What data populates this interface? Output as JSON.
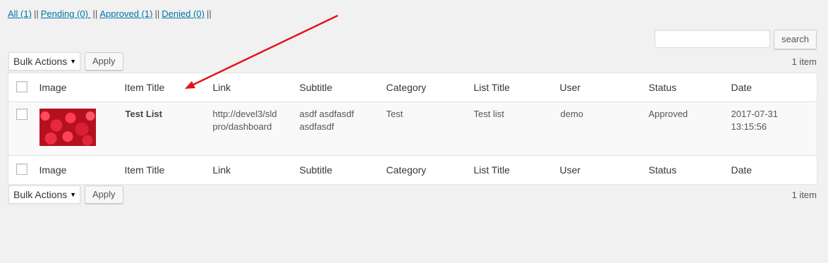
{
  "filters": {
    "all": "All (1)",
    "pending": "Pending (0) ",
    "approved": "Approved (1)",
    "denied": "Denied (0)",
    "separator": "||"
  },
  "search": {
    "button": "search",
    "value": ""
  },
  "tablenav": {
    "bulk_actions": "Bulk Actions",
    "apply": "Apply",
    "count": "1 item"
  },
  "columns": {
    "image": "Image",
    "item_title": "Item Title",
    "link": "Link",
    "subtitle": "Subtitle",
    "category": "Category",
    "list_title": "List Title",
    "user": "User",
    "status": "Status",
    "date": "Date"
  },
  "rows": [
    {
      "item_title": "Test List",
      "link_line1": "http://devel3/sld",
      "link_line2": "pro/dashboard",
      "subtitle_line1": "asdf asdfasdf",
      "subtitle_line2": "asdfasdf",
      "category": "Test",
      "list_title": "Test list",
      "user": "demo",
      "status": "Approved",
      "date_line1": "2017-07-31",
      "date_line2": "13:15:56"
    }
  ],
  "colors": {
    "link": "#0073aa",
    "approved": "#1f9a2b",
    "arrow": "#e2141a"
  }
}
